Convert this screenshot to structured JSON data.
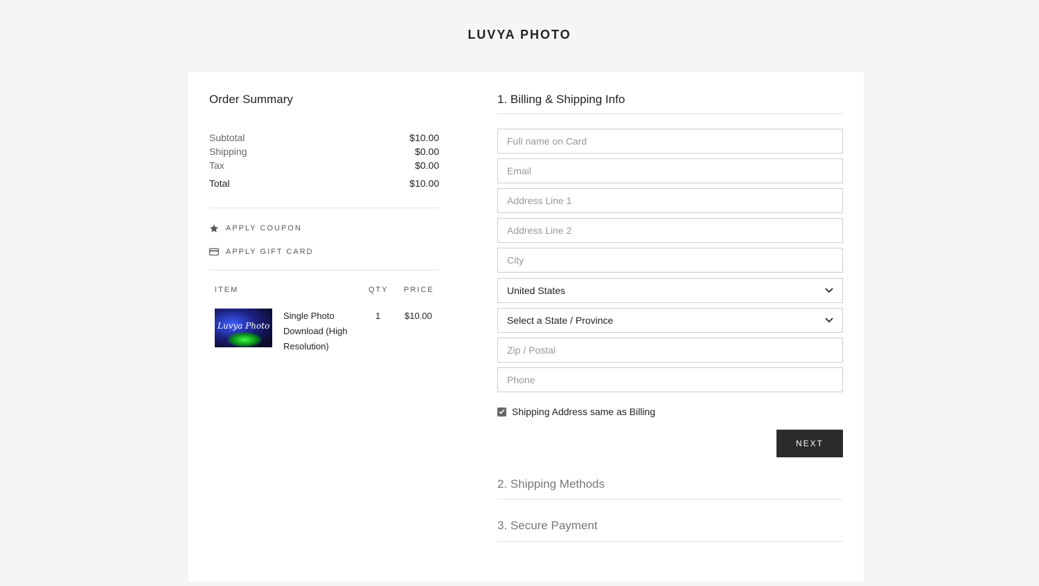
{
  "brand": "LUVYA PHOTO",
  "summary": {
    "title": "Order Summary",
    "rows": [
      {
        "label": "Subtotal",
        "value": "$10.00"
      },
      {
        "label": "Shipping",
        "value": "$0.00"
      },
      {
        "label": "Tax",
        "value": "$0.00"
      }
    ],
    "total": {
      "label": "Total",
      "value": "$10.00"
    },
    "coupon_label": "APPLY COUPON",
    "gift_card_label": "APPLY GIFT CARD",
    "columns": {
      "item": "ITEM",
      "qty": "QTY",
      "price": "PRICE"
    },
    "item": {
      "name": "Single Photo Download (High Resolution)",
      "qty": "1",
      "price": "$10.00",
      "thumb_text": "Luvya Photo"
    }
  },
  "billing": {
    "title": "1. Billing & Shipping Info",
    "fields": {
      "full_name": "Full name on Card",
      "email": "Email",
      "address1": "Address Line 1",
      "address2": "Address Line 2",
      "city": "City",
      "zip": "Zip / Postal",
      "phone": "Phone"
    },
    "country": "United States",
    "state": "Select a State / Province",
    "same_address_label": "Shipping Address same as Billing",
    "same_address_checked": true,
    "next_label": "NEXT"
  },
  "shipping_methods_title": "2. Shipping Methods",
  "secure_payment_title": "3. Secure Payment",
  "colors": {
    "accent": "#2b2b2b",
    "background": "#f5f5f5"
  }
}
